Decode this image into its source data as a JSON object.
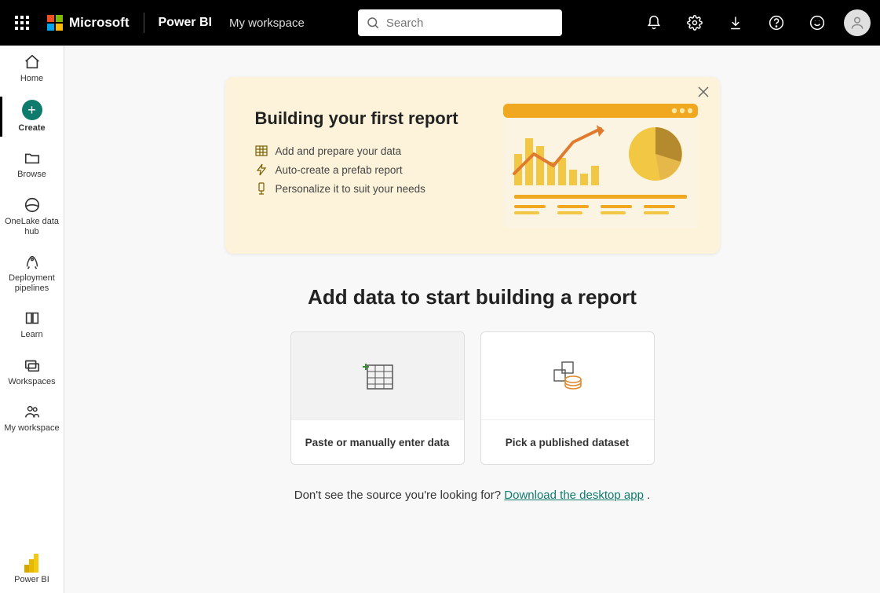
{
  "header": {
    "brand": "Microsoft",
    "app": "Power BI",
    "workspace": "My workspace",
    "search_placeholder": "Search"
  },
  "sidebar": {
    "items": [
      {
        "label": "Home"
      },
      {
        "label": "Create"
      },
      {
        "label": "Browse"
      },
      {
        "label": "OneLake data hub"
      },
      {
        "label": "Deployment pipelines"
      },
      {
        "label": "Learn"
      },
      {
        "label": "Workspaces"
      },
      {
        "label": "My workspace"
      }
    ],
    "footer_label": "Power BI"
  },
  "banner": {
    "title": "Building your first report",
    "steps": [
      "Add and prepare your data",
      "Auto-create a prefab report",
      "Personalize it to suit your needs"
    ]
  },
  "main": {
    "heading": "Add data to start building a report",
    "cards": [
      {
        "label": "Paste or manually enter data"
      },
      {
        "label": "Pick a published dataset"
      }
    ],
    "footer_prefix": "Don't see the source you're looking for?  ",
    "footer_link": "Download the desktop app",
    "footer_suffix": " ."
  }
}
